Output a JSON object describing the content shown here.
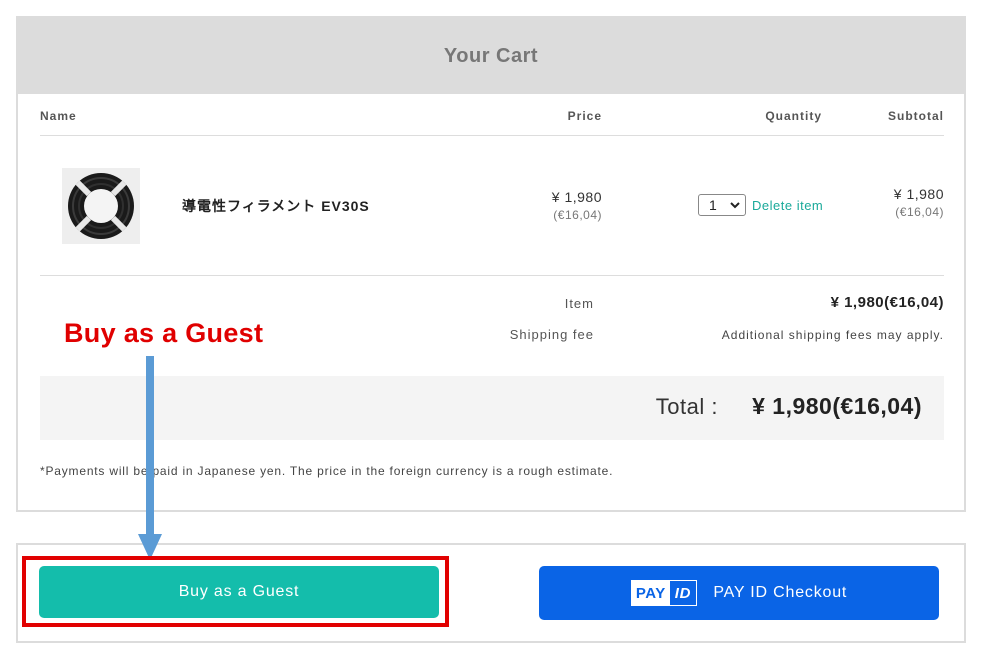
{
  "cart": {
    "title": "Your Cart",
    "columns": {
      "name": "Name",
      "price": "Price",
      "quantity": "Quantity",
      "subtotal": "Subtotal"
    },
    "items": [
      {
        "name": "導電性フィラメント EV30S",
        "price": "¥ 1,980",
        "price_foreign": "(€16,04)",
        "quantity": "1",
        "delete_label": "Delete item",
        "subtotal": "¥ 1,980",
        "subtotal_foreign": "(€16,04)"
      }
    ],
    "summary": {
      "item_label": "Item",
      "item_value": "¥ 1,980(€16,04)",
      "shipping_label": "Shipping fee",
      "shipping_value": "Additional shipping fees may apply.",
      "total_label": "Total :",
      "total_value": "¥ 1,980(€16,04)"
    },
    "note": "*Payments will be paid in Japanese yen. The price in the foreign currency is a rough estimate."
  },
  "checkout": {
    "guest_label": "Buy as a Guest",
    "payid_logo_pay": "PAY",
    "payid_logo_id": "ID",
    "payid_label": "PAY ID Checkout"
  },
  "annotation": {
    "text": "Buy as a Guest",
    "color": "#e00000",
    "arrow_color": "#5b9bd5"
  },
  "colors": {
    "accent_teal": "#14bdab",
    "payid_blue": "#0a64e6",
    "header_gray": "#dcdcdc"
  }
}
